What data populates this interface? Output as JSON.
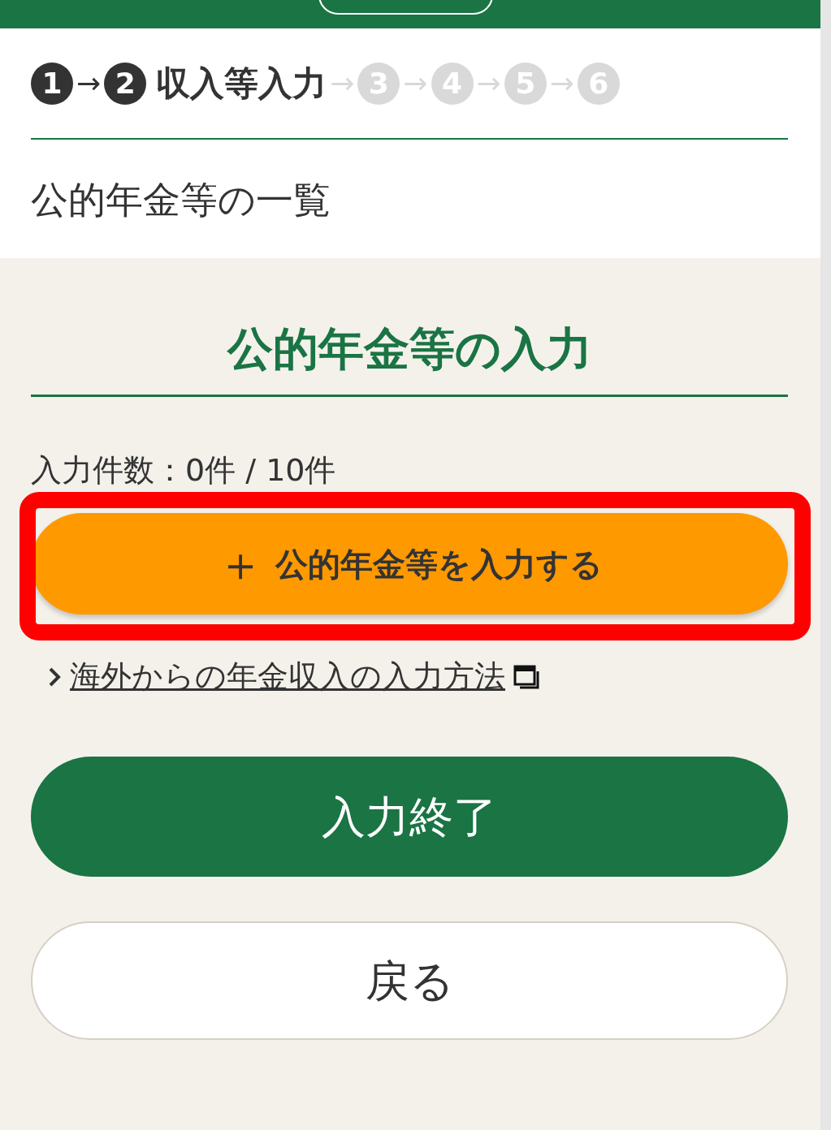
{
  "steps": [
    {
      "number": "1",
      "reached": true
    },
    {
      "number": "2",
      "reached": true,
      "label": "収入等入力"
    },
    {
      "number": "3",
      "reached": false
    },
    {
      "number": "4",
      "reached": false
    },
    {
      "number": "5",
      "reached": false
    },
    {
      "number": "6",
      "reached": false
    }
  ],
  "arrow": "→",
  "page_title": "公的年金等の一覧",
  "section_title": "公的年金等の入力",
  "count_text": "入力件数：0件 / 10件",
  "add_button": {
    "icon": "＋",
    "label": "公的年金等を入力する",
    "highlighted": true
  },
  "help_link": {
    "label": "海外からの年金収入の入力方法"
  },
  "finish_button": "入力終了",
  "back_button": "戻る"
}
